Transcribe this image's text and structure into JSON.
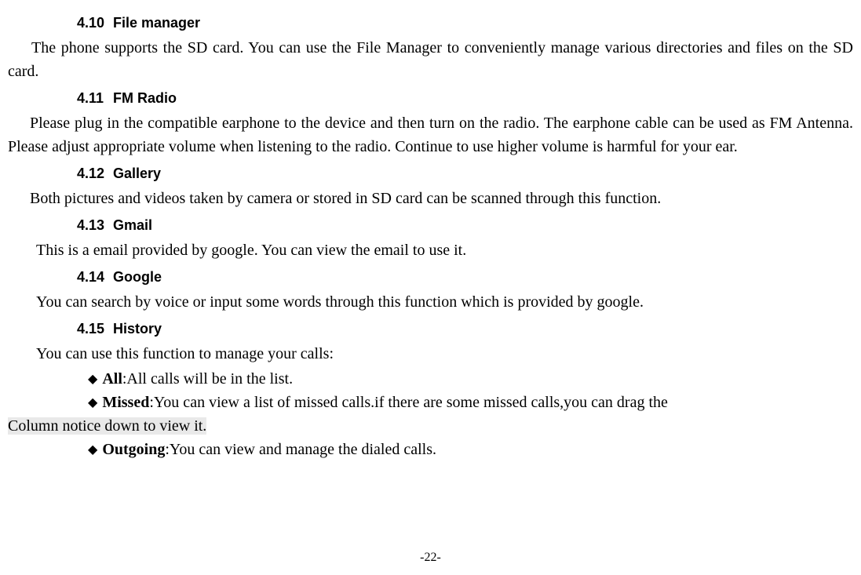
{
  "sections": {
    "s410": {
      "num": "4.10",
      "title": "File manager",
      "body": "The  phone  supports  the  SD  card.  You  can  use  the  File  Manager  to  conveniently  manage  various directories and files on the SD card."
    },
    "s411": {
      "num": "4.11",
      "title": "FM Radio",
      "body": "Please plug in the compatible earphone to the device and then turn on the radio. The earphone cable can be used as FM Antenna. Please adjust appropriate volume when listening to the radio. Continue to use higher volume is harmful for your ear."
    },
    "s412": {
      "num": "4.12",
      "title": "Gallery",
      "body": "Both pictures and videos taken by camera or stored in SD card can be scanned through this function."
    },
    "s413": {
      "num": "4.13",
      "title": "Gmail",
      "body": "This is a email provided by google. You can view the email to use it."
    },
    "s414": {
      "num": "4.14",
      "title": "Google",
      "body": "You can search by voice or input some words through this function which is provided by google."
    },
    "s415": {
      "num": "4.15",
      "title": "History",
      "body": "You can use this function to manage your calls:"
    }
  },
  "bullets": {
    "all": {
      "label": "All",
      "text": ":All calls will be in the list."
    },
    "missed": {
      "label": "Missed",
      "text_part1": ":You  can  view  a  list  of  missed  calls.if  there  are  some  missed  calls,you  can  drag  the ",
      "text_part2": "Column notice down to view it."
    },
    "outgoing": {
      "label": "Outgoing",
      "text": ":You can view and manage the dialed calls."
    }
  },
  "glyphs": {
    "diamond": "◆"
  },
  "page_number": "-22-"
}
